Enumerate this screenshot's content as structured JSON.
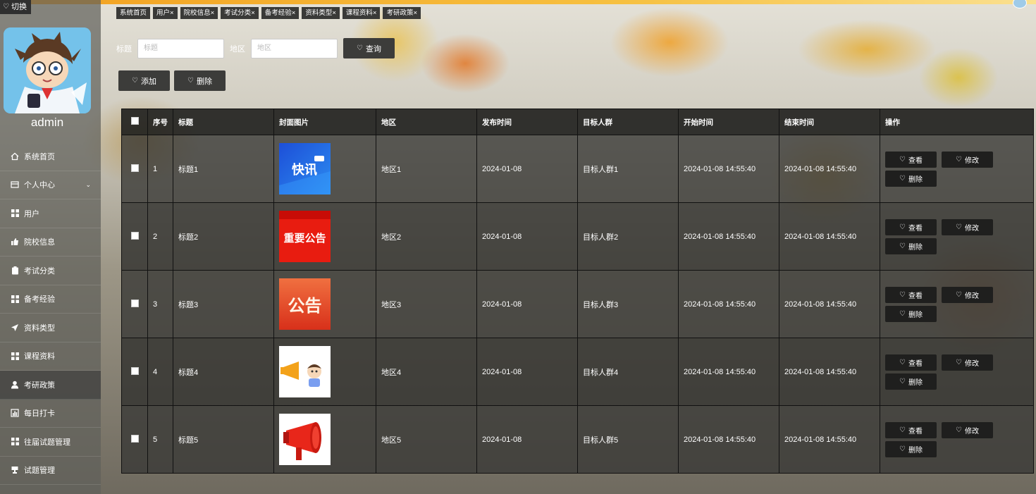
{
  "app": {
    "switch_label": "切换",
    "username": "admin"
  },
  "menu": [
    {
      "label": "系统首页",
      "icon": "home-icon"
    },
    {
      "label": "个人中心",
      "icon": "panel-icon",
      "has_children": true
    },
    {
      "label": "用户",
      "icon": "grid-icon"
    },
    {
      "label": "院校信息",
      "icon": "thumb-icon"
    },
    {
      "label": "考试分类",
      "icon": "clipboard-icon"
    },
    {
      "label": "备考经验",
      "icon": "grid-icon"
    },
    {
      "label": "资料类型",
      "icon": "send-icon"
    },
    {
      "label": "课程资料",
      "icon": "grid-icon"
    },
    {
      "label": "考研政策",
      "icon": "user-icon",
      "active": true
    },
    {
      "label": "每日打卡",
      "icon": "chart-icon"
    },
    {
      "label": "往届试题管理",
      "icon": "grid-icon"
    },
    {
      "label": "试题管理",
      "icon": "cup-icon"
    }
  ],
  "tabs": [
    "系统首页",
    "用户",
    "院校信息",
    "考试分类",
    "备考经验",
    "资料类型",
    "课程资料",
    "考研政策"
  ],
  "tab_close": "×",
  "search": {
    "title_label": "标题",
    "title_placeholder": "标题",
    "region_label": "地区",
    "region_placeholder": "地区",
    "query_label": "查询"
  },
  "toolbar": {
    "add_label": "添加",
    "delete_label": "删除"
  },
  "table": {
    "headers": [
      "序号",
      "标题",
      "封面图片",
      "地区",
      "发布时间",
      "目标人群",
      "开始时间",
      "结束时间",
      "操作"
    ],
    "rows": [
      {
        "no": "1",
        "title": "标题1",
        "cover": "快讯",
        "region": "地区1",
        "publish": "2024-01-08",
        "target": "目标人群1",
        "start": "2024-01-08 14:55:40",
        "end": "2024-01-08 14:55:40"
      },
      {
        "no": "2",
        "title": "标题2",
        "cover": "重要公告",
        "region": "地区2",
        "publish": "2024-01-08",
        "target": "目标人群2",
        "start": "2024-01-08 14:55:40",
        "end": "2024-01-08 14:55:40"
      },
      {
        "no": "3",
        "title": "标题3",
        "cover": "公告",
        "region": "地区3",
        "publish": "2024-01-08",
        "target": "目标人群3",
        "start": "2024-01-08 14:55:40",
        "end": "2024-01-08 14:55:40"
      },
      {
        "no": "4",
        "title": "标题4",
        "cover": "",
        "region": "地区4",
        "publish": "2024-01-08",
        "target": "目标人群4",
        "start": "2024-01-08 14:55:40",
        "end": "2024-01-08 14:55:40"
      },
      {
        "no": "5",
        "title": "标题5",
        "cover": "",
        "region": "地区5",
        "publish": "2024-01-08",
        "target": "目标人群5",
        "start": "2024-01-08 14:55:40",
        "end": "2024-01-08 14:55:40"
      }
    ],
    "ops": {
      "view": "查看",
      "edit": "修改",
      "delete": "删除"
    }
  }
}
